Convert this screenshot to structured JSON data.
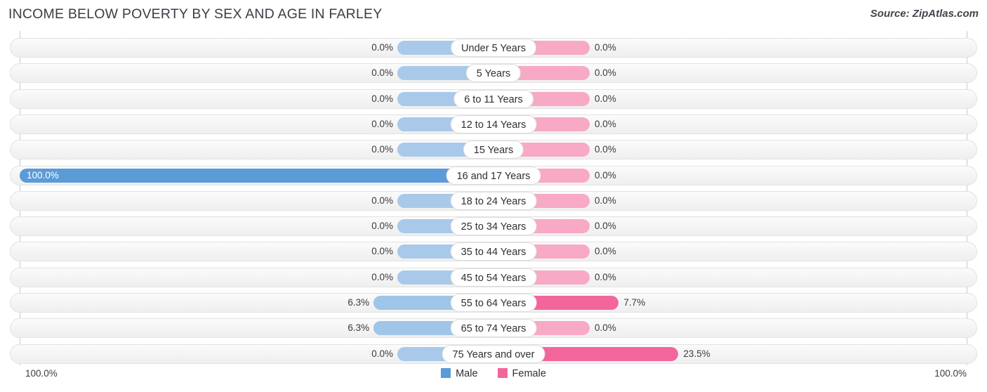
{
  "header": {
    "title": "INCOME BELOW POVERTY BY SEX AND AGE IN FARLEY",
    "source": "Source: ZipAtlas.com"
  },
  "footer": {
    "axis_left": "100.0%",
    "axis_right": "100.0%",
    "legend": [
      {
        "label": "Male",
        "color": "#5b9bd8",
        "key": "male"
      },
      {
        "label": "Female",
        "color": "#f2669c",
        "key": "female"
      }
    ]
  },
  "chart_data": {
    "type": "bar",
    "orientation": "horizontal-diverging",
    "title": "INCOME BELOW POVERTY BY SEX AND AGE IN FARLEY",
    "xlabel": "",
    "ylabel": "",
    "xlim": [
      100.0,
      100.0
    ],
    "grid": false,
    "legend_position": "bottom-center",
    "categories": [
      "Under 5 Years",
      "5 Years",
      "6 to 11 Years",
      "12 to 14 Years",
      "15 Years",
      "16 and 17 Years",
      "18 to 24 Years",
      "25 to 34 Years",
      "35 to 44 Years",
      "45 to 54 Years",
      "55 to 64 Years",
      "65 to 74 Years",
      "75 Years and over"
    ],
    "series": [
      {
        "name": "Male",
        "values": [
          0.0,
          0.0,
          0.0,
          0.0,
          0.0,
          100.0,
          0.0,
          0.0,
          0.0,
          0.0,
          6.3,
          6.3,
          0.0
        ],
        "labels": [
          "0.0%",
          "0.0%",
          "0.0%",
          "0.0%",
          "0.0%",
          "100.0%",
          "0.0%",
          "0.0%",
          "0.0%",
          "0.0%",
          "6.3%",
          "6.3%",
          "0.0%"
        ]
      },
      {
        "name": "Female",
        "values": [
          0.0,
          0.0,
          0.0,
          0.0,
          0.0,
          0.0,
          0.0,
          0.0,
          0.0,
          0.0,
          7.7,
          0.0,
          23.5
        ],
        "labels": [
          "0.0%",
          "0.0%",
          "0.0%",
          "0.0%",
          "0.0%",
          "0.0%",
          "0.0%",
          "0.0%",
          "0.0%",
          "0.0%",
          "7.7%",
          "0.0%",
          "23.5%"
        ]
      }
    ]
  },
  "rows": [
    {
      "category": "Under 5 Years",
      "male_label": "0.0%",
      "female_label": "0.0%",
      "male_value": 0.0,
      "female_value": 0.0
    },
    {
      "category": "5 Years",
      "male_label": "0.0%",
      "female_label": "0.0%",
      "male_value": 0.0,
      "female_value": 0.0
    },
    {
      "category": "6 to 11 Years",
      "male_label": "0.0%",
      "female_label": "0.0%",
      "male_value": 0.0,
      "female_value": 0.0
    },
    {
      "category": "12 to 14 Years",
      "male_label": "0.0%",
      "female_label": "0.0%",
      "male_value": 0.0,
      "female_value": 0.0
    },
    {
      "category": "15 Years",
      "male_label": "0.0%",
      "female_label": "0.0%",
      "male_value": 0.0,
      "female_value": 0.0
    },
    {
      "category": "16 and 17 Years",
      "male_label": "100.0%",
      "female_label": "0.0%",
      "male_value": 100.0,
      "female_value": 0.0
    },
    {
      "category": "18 to 24 Years",
      "male_label": "0.0%",
      "female_label": "0.0%",
      "male_value": 0.0,
      "female_value": 0.0
    },
    {
      "category": "25 to 34 Years",
      "male_label": "0.0%",
      "female_label": "0.0%",
      "male_value": 0.0,
      "female_value": 0.0
    },
    {
      "category": "35 to 44 Years",
      "male_label": "0.0%",
      "female_label": "0.0%",
      "male_value": 0.0,
      "female_value": 0.0
    },
    {
      "category": "45 to 54 Years",
      "male_label": "0.0%",
      "female_label": "0.0%",
      "male_value": 0.0,
      "female_value": 0.0
    },
    {
      "category": "55 to 64 Years",
      "male_label": "6.3%",
      "female_label": "7.7%",
      "male_value": 6.3,
      "female_value": 7.7
    },
    {
      "category": "65 to 74 Years",
      "male_label": "6.3%",
      "female_label": "0.0%",
      "male_value": 6.3,
      "female_value": 0.0
    },
    {
      "category": "75 Years and over",
      "male_label": "0.0%",
      "female_label": "23.5%",
      "male_value": 0.0,
      "female_value": 23.5
    }
  ]
}
